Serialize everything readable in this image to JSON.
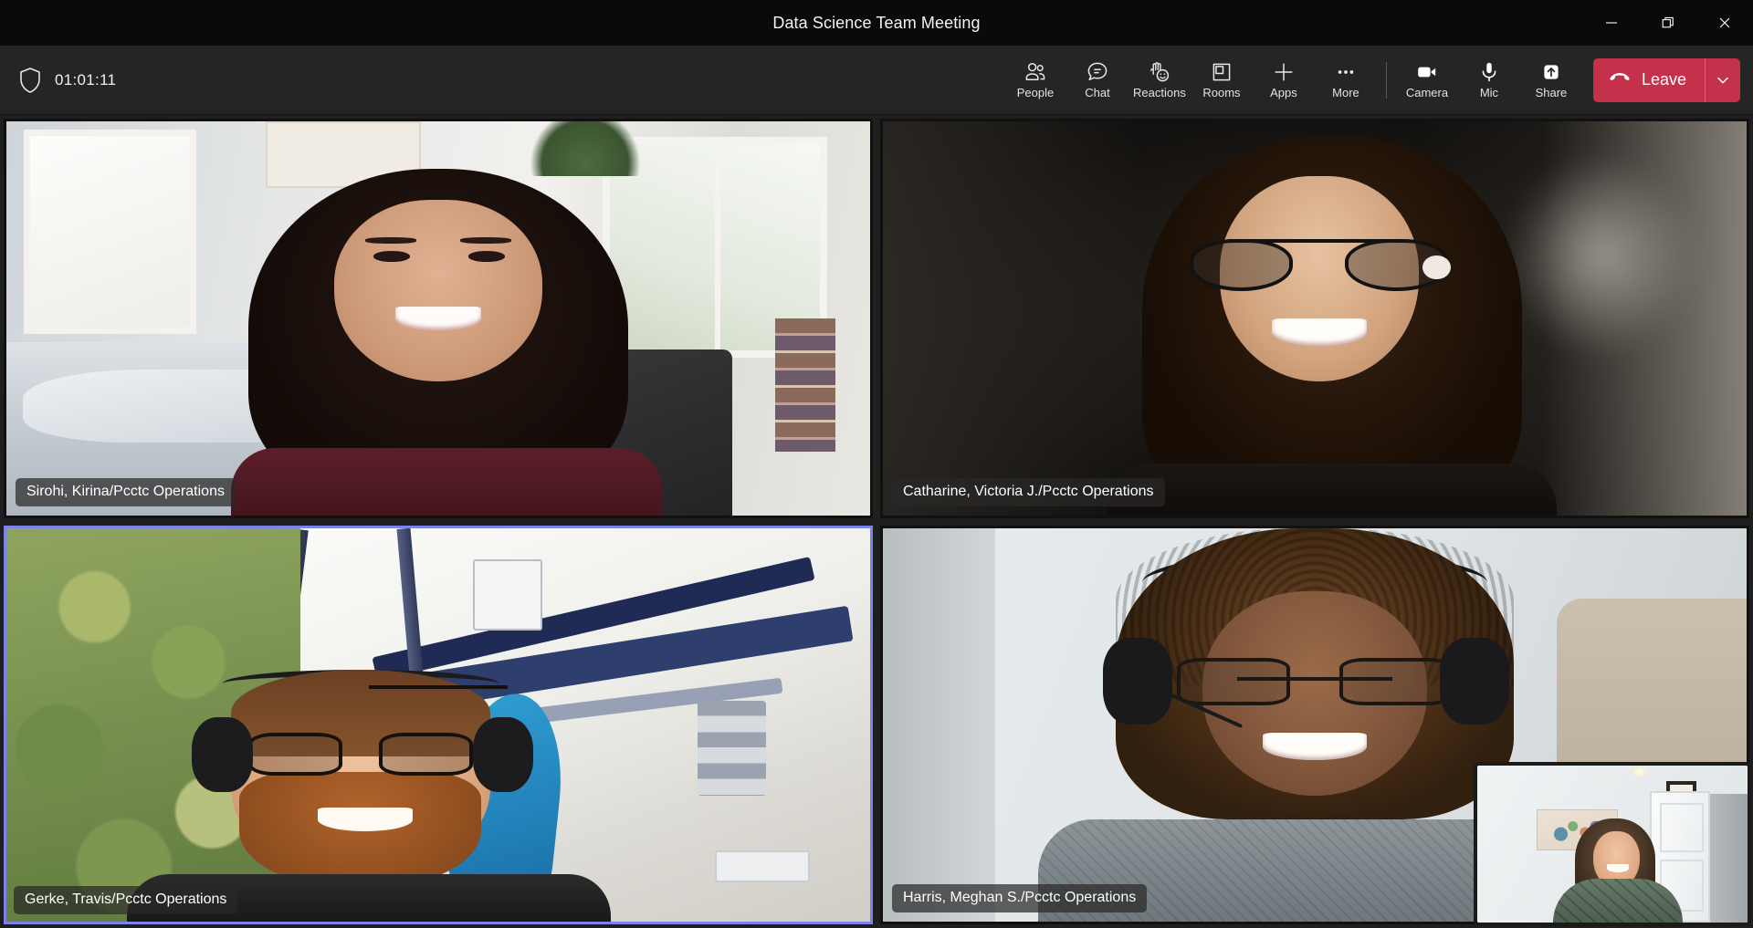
{
  "window": {
    "title": "Data Science Team Meeting",
    "controls": [
      {
        "name": "minimize",
        "glyph": "minimize-icon"
      },
      {
        "name": "restore",
        "glyph": "restore-icon"
      },
      {
        "name": "close",
        "glyph": "close-icon"
      }
    ]
  },
  "controlbar": {
    "shield_icon": "shield-icon",
    "timer": "01:01:11",
    "buttons": [
      {
        "id": "people",
        "label": "People",
        "icon": "people-icon"
      },
      {
        "id": "chat",
        "label": "Chat",
        "icon": "chat-icon"
      },
      {
        "id": "reactions",
        "label": "Reactions",
        "icon": "reactions-icon"
      },
      {
        "id": "rooms",
        "label": "Rooms",
        "icon": "rooms-icon"
      },
      {
        "id": "apps",
        "label": "Apps",
        "icon": "plus-icon"
      },
      {
        "id": "more",
        "label": "More",
        "icon": "ellipsis-icon"
      },
      {
        "id": "camera",
        "label": "Camera",
        "icon": "camera-icon"
      },
      {
        "id": "mic",
        "label": "Mic",
        "icon": "microphone-icon"
      },
      {
        "id": "share",
        "label": "Share",
        "icon": "share-arrow-icon"
      }
    ],
    "leave": {
      "label": "Leave",
      "icon": "hangup-phone-icon",
      "caret_icon": "chevron-down-icon",
      "color": "#c4314b"
    }
  },
  "stage": {
    "active_speaker_color": "#7b83eb",
    "tiles": [
      {
        "id": "sirohi",
        "name": "Sirohi, Kirina/Pcctc Operations",
        "active": false
      },
      {
        "id": "catharine",
        "name": "Catharine, Victoria J./Pcctc Operations",
        "active": false
      },
      {
        "id": "gerke",
        "name": "Gerke, Travis/Pcctc Operations",
        "active": true
      },
      {
        "id": "harris",
        "name": "Harris, Meghan S./Pcctc Operations",
        "active": false
      }
    ],
    "self_view": {
      "id": "self-view",
      "name": ""
    }
  }
}
